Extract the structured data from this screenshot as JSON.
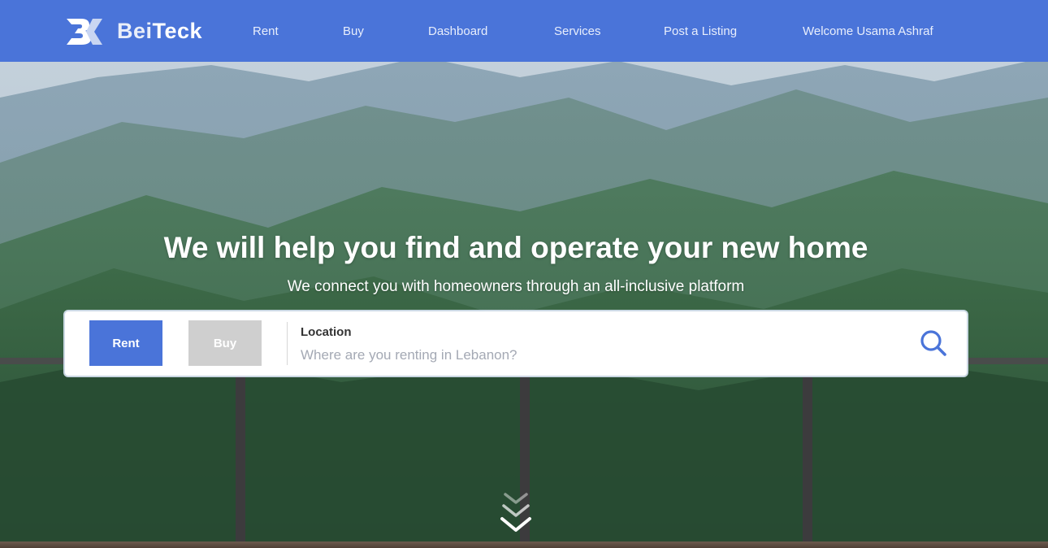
{
  "brand": {
    "name_part1": "Bei",
    "name_part2": "Teck",
    "primary_color": "#4a74d9",
    "logo_icon": "bk-logo-icon"
  },
  "nav": {
    "items": [
      {
        "label": "Rent"
      },
      {
        "label": "Buy"
      },
      {
        "label": "Dashboard"
      },
      {
        "label": "Services"
      },
      {
        "label": "Post a Listing"
      },
      {
        "label": "Welcome Usama Ashraf"
      }
    ]
  },
  "hero": {
    "title": "We will help you find and operate your new home",
    "subtitle": "We connect you with homeowners through an all-inclusive platform"
  },
  "search": {
    "rent_label": "Rent",
    "buy_label": "Buy",
    "active_mode": "Rent",
    "location_label": "Location",
    "location_placeholder": "Where are you renting in Lebanon?",
    "location_value": "",
    "search_icon": "search-icon"
  },
  "scroll": {
    "icon": "chevron-double-down-icon"
  }
}
